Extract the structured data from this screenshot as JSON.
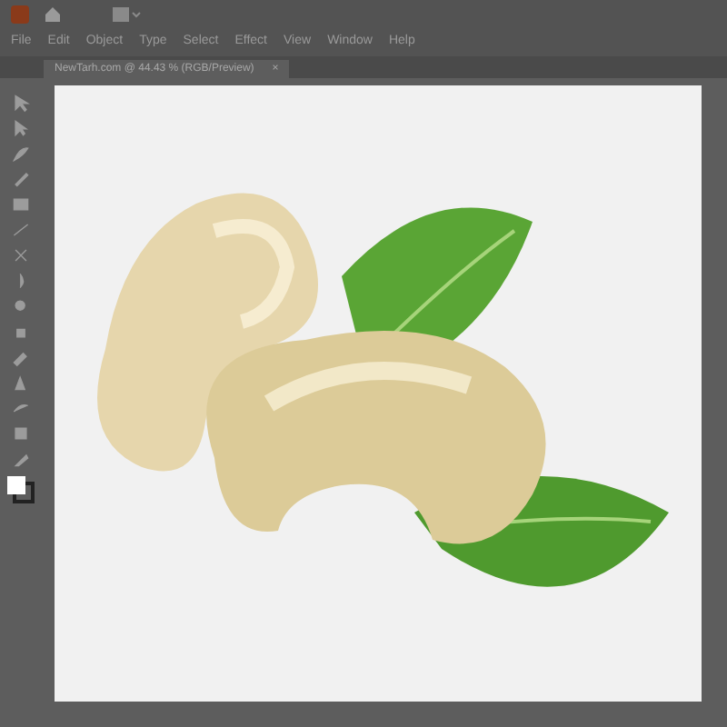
{
  "menu_bar": {
    "items": [
      "File",
      "Edit",
      "Object",
      "Type",
      "Select",
      "Effect",
      "View",
      "Window",
      "Help"
    ]
  },
  "document_tab": {
    "title": "NewTarh.com @ 44.43 % (RGB/Preview)",
    "close": "×",
    "selected": true
  }
}
